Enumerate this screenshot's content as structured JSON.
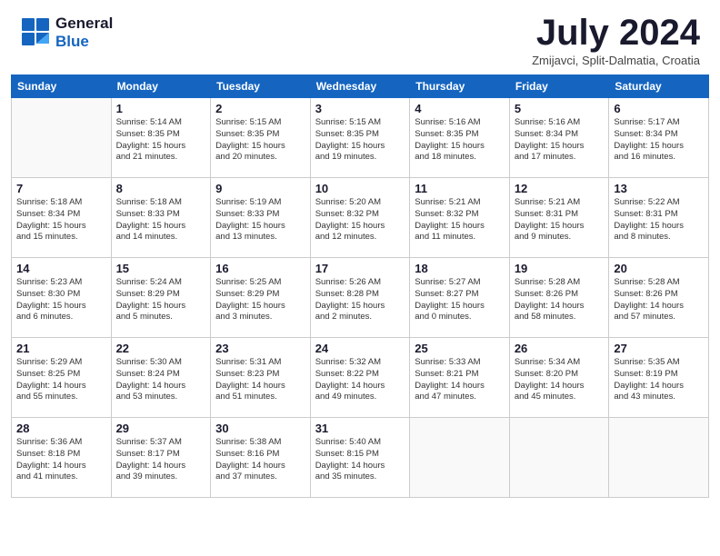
{
  "header": {
    "logo_line1": "General",
    "logo_line2": "Blue",
    "month": "July 2024",
    "location": "Zmijavci, Split-Dalmatia, Croatia"
  },
  "calendar": {
    "days_of_week": [
      "Sunday",
      "Monday",
      "Tuesday",
      "Wednesday",
      "Thursday",
      "Friday",
      "Saturday"
    ],
    "weeks": [
      [
        {
          "day": "",
          "info": ""
        },
        {
          "day": "1",
          "info": "Sunrise: 5:14 AM\nSunset: 8:35 PM\nDaylight: 15 hours\nand 21 minutes."
        },
        {
          "day": "2",
          "info": "Sunrise: 5:15 AM\nSunset: 8:35 PM\nDaylight: 15 hours\nand 20 minutes."
        },
        {
          "day": "3",
          "info": "Sunrise: 5:15 AM\nSunset: 8:35 PM\nDaylight: 15 hours\nand 19 minutes."
        },
        {
          "day": "4",
          "info": "Sunrise: 5:16 AM\nSunset: 8:35 PM\nDaylight: 15 hours\nand 18 minutes."
        },
        {
          "day": "5",
          "info": "Sunrise: 5:16 AM\nSunset: 8:34 PM\nDaylight: 15 hours\nand 17 minutes."
        },
        {
          "day": "6",
          "info": "Sunrise: 5:17 AM\nSunset: 8:34 PM\nDaylight: 15 hours\nand 16 minutes."
        }
      ],
      [
        {
          "day": "7",
          "info": "Sunrise: 5:18 AM\nSunset: 8:34 PM\nDaylight: 15 hours\nand 15 minutes."
        },
        {
          "day": "8",
          "info": "Sunrise: 5:18 AM\nSunset: 8:33 PM\nDaylight: 15 hours\nand 14 minutes."
        },
        {
          "day": "9",
          "info": "Sunrise: 5:19 AM\nSunset: 8:33 PM\nDaylight: 15 hours\nand 13 minutes."
        },
        {
          "day": "10",
          "info": "Sunrise: 5:20 AM\nSunset: 8:32 PM\nDaylight: 15 hours\nand 12 minutes."
        },
        {
          "day": "11",
          "info": "Sunrise: 5:21 AM\nSunset: 8:32 PM\nDaylight: 15 hours\nand 11 minutes."
        },
        {
          "day": "12",
          "info": "Sunrise: 5:21 AM\nSunset: 8:31 PM\nDaylight: 15 hours\nand 9 minutes."
        },
        {
          "day": "13",
          "info": "Sunrise: 5:22 AM\nSunset: 8:31 PM\nDaylight: 15 hours\nand 8 minutes."
        }
      ],
      [
        {
          "day": "14",
          "info": "Sunrise: 5:23 AM\nSunset: 8:30 PM\nDaylight: 15 hours\nand 6 minutes."
        },
        {
          "day": "15",
          "info": "Sunrise: 5:24 AM\nSunset: 8:29 PM\nDaylight: 15 hours\nand 5 minutes."
        },
        {
          "day": "16",
          "info": "Sunrise: 5:25 AM\nSunset: 8:29 PM\nDaylight: 15 hours\nand 3 minutes."
        },
        {
          "day": "17",
          "info": "Sunrise: 5:26 AM\nSunset: 8:28 PM\nDaylight: 15 hours\nand 2 minutes."
        },
        {
          "day": "18",
          "info": "Sunrise: 5:27 AM\nSunset: 8:27 PM\nDaylight: 15 hours\nand 0 minutes."
        },
        {
          "day": "19",
          "info": "Sunrise: 5:28 AM\nSunset: 8:26 PM\nDaylight: 14 hours\nand 58 minutes."
        },
        {
          "day": "20",
          "info": "Sunrise: 5:28 AM\nSunset: 8:26 PM\nDaylight: 14 hours\nand 57 minutes."
        }
      ],
      [
        {
          "day": "21",
          "info": "Sunrise: 5:29 AM\nSunset: 8:25 PM\nDaylight: 14 hours\nand 55 minutes."
        },
        {
          "day": "22",
          "info": "Sunrise: 5:30 AM\nSunset: 8:24 PM\nDaylight: 14 hours\nand 53 minutes."
        },
        {
          "day": "23",
          "info": "Sunrise: 5:31 AM\nSunset: 8:23 PM\nDaylight: 14 hours\nand 51 minutes."
        },
        {
          "day": "24",
          "info": "Sunrise: 5:32 AM\nSunset: 8:22 PM\nDaylight: 14 hours\nand 49 minutes."
        },
        {
          "day": "25",
          "info": "Sunrise: 5:33 AM\nSunset: 8:21 PM\nDaylight: 14 hours\nand 47 minutes."
        },
        {
          "day": "26",
          "info": "Sunrise: 5:34 AM\nSunset: 8:20 PM\nDaylight: 14 hours\nand 45 minutes."
        },
        {
          "day": "27",
          "info": "Sunrise: 5:35 AM\nSunset: 8:19 PM\nDaylight: 14 hours\nand 43 minutes."
        }
      ],
      [
        {
          "day": "28",
          "info": "Sunrise: 5:36 AM\nSunset: 8:18 PM\nDaylight: 14 hours\nand 41 minutes."
        },
        {
          "day": "29",
          "info": "Sunrise: 5:37 AM\nSunset: 8:17 PM\nDaylight: 14 hours\nand 39 minutes."
        },
        {
          "day": "30",
          "info": "Sunrise: 5:38 AM\nSunset: 8:16 PM\nDaylight: 14 hours\nand 37 minutes."
        },
        {
          "day": "31",
          "info": "Sunrise: 5:40 AM\nSunset: 8:15 PM\nDaylight: 14 hours\nand 35 minutes."
        },
        {
          "day": "",
          "info": ""
        },
        {
          "day": "",
          "info": ""
        },
        {
          "day": "",
          "info": ""
        }
      ]
    ]
  }
}
